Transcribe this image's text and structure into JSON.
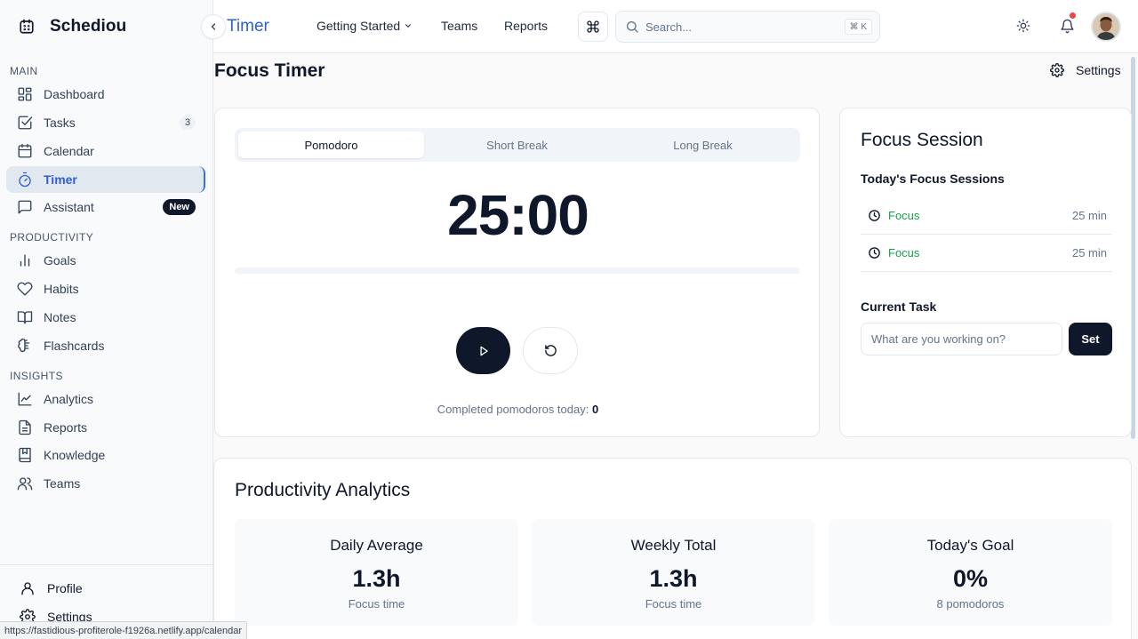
{
  "app": {
    "name": "Schediou"
  },
  "sidebar": {
    "sections": [
      {
        "title": "MAIN"
      },
      {
        "title": "PRODUCTIVITY"
      },
      {
        "title": "INSIGHTS"
      }
    ],
    "items": [
      {
        "label": "Dashboard",
        "icon": "dashboard-icon"
      },
      {
        "label": "Tasks",
        "icon": "tasks-icon",
        "badge": "3"
      },
      {
        "label": "Calendar",
        "icon": "calendar-icon"
      },
      {
        "label": "Timer",
        "icon": "timer-icon",
        "active": true
      },
      {
        "label": "Assistant",
        "icon": "chat-icon",
        "badge": "New"
      },
      {
        "label": "Goals",
        "icon": "bar-chart-icon"
      },
      {
        "label": "Habits",
        "icon": "heart-icon"
      },
      {
        "label": "Notes",
        "icon": "book-icon"
      },
      {
        "label": "Flashcards",
        "icon": "brain-icon"
      },
      {
        "label": "Analytics",
        "icon": "line-chart-icon"
      },
      {
        "label": "Reports",
        "icon": "document-icon"
      },
      {
        "label": "Knowledge",
        "icon": "bookmark-book-icon"
      },
      {
        "label": "Teams",
        "icon": "users-icon"
      }
    ],
    "footer": [
      {
        "label": "Profile",
        "icon": "user-icon"
      },
      {
        "label": "Settings",
        "icon": "gear-icon"
      }
    ]
  },
  "header": {
    "title": "Timer",
    "nav": [
      {
        "label": "Getting Started",
        "has_dropdown": true
      },
      {
        "label": "Teams"
      },
      {
        "label": "Reports"
      }
    ],
    "search": {
      "placeholder": "Search...",
      "shortcut": "⌘ K"
    },
    "notification_dot_color": "#ef4444"
  },
  "page": {
    "title": "Focus Timer",
    "settings_label": "Settings"
  },
  "timer": {
    "tabs": [
      "Pomodoro",
      "Short Break",
      "Long Break"
    ],
    "active_tab": 0,
    "display": "25:00",
    "progress": 0,
    "completed_label": "Completed pomodoros today:",
    "completed_count": "0"
  },
  "focus_session": {
    "title": "Focus Session",
    "sessions_heading": "Today's Focus Sessions",
    "sessions": [
      {
        "label": "Focus",
        "duration": "25 min"
      },
      {
        "label": "Focus",
        "duration": "25 min"
      }
    ],
    "current_task_heading": "Current Task",
    "task_placeholder": "What are you working on?",
    "set_label": "Set"
  },
  "analytics": {
    "title": "Productivity Analytics",
    "stats": [
      {
        "label": "Daily Average",
        "value": "1.3h",
        "sub": "Focus time"
      },
      {
        "label": "Weekly Total",
        "value": "1.3h",
        "sub": "Focus time"
      },
      {
        "label": "Today's Goal",
        "value": "0%",
        "sub": "8 pomodoros"
      }
    ]
  },
  "status_bar": {
    "url": "https://fastidious-profiterole-f1926a.netlify.app/calendar"
  },
  "colors": {
    "accent": "#2f5fd0",
    "dark": "#0f172a",
    "success": "#16a34a"
  }
}
